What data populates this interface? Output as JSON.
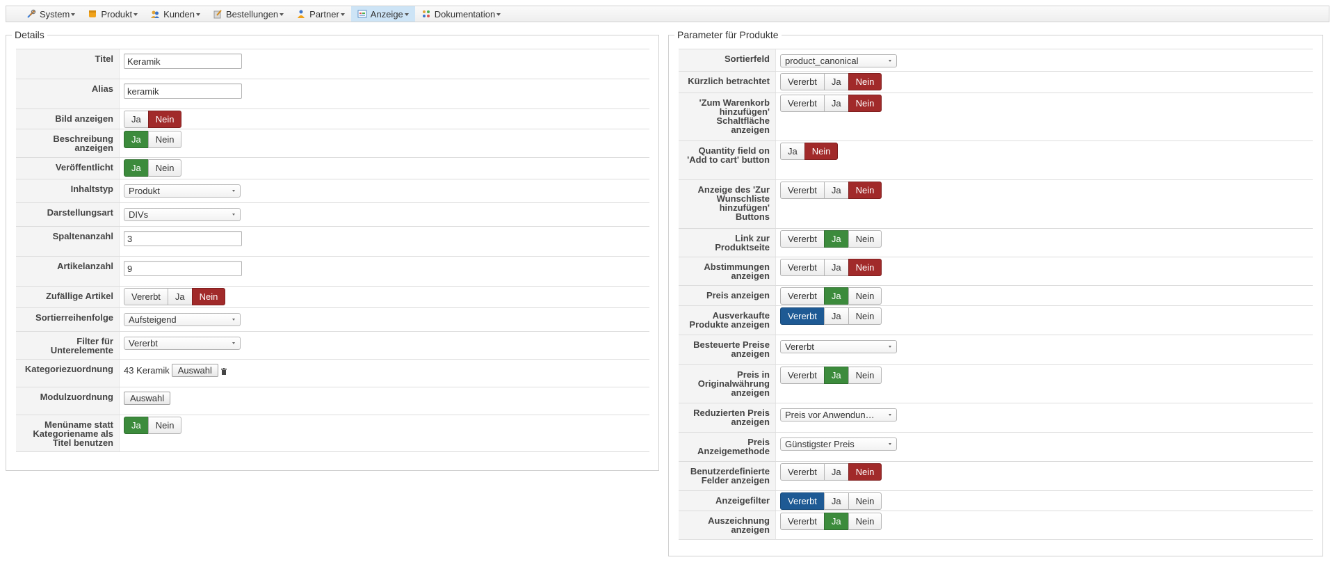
{
  "menu": [
    {
      "label": "System",
      "icon": "tools-icon"
    },
    {
      "label": "Produkt",
      "icon": "product-box-icon"
    },
    {
      "label": "Kunden",
      "icon": "customers-icon"
    },
    {
      "label": "Bestellungen",
      "icon": "orders-icon"
    },
    {
      "label": "Partner",
      "icon": "partner-icon"
    },
    {
      "label": "Anzeige",
      "icon": "display-icon",
      "active": true
    },
    {
      "label": "Dokumentation",
      "icon": "documentation-icon"
    }
  ],
  "details": {
    "legend": "Details",
    "titel": {
      "label": "Titel",
      "value": "Keramik"
    },
    "alias": {
      "label": "Alias",
      "value": "keramik"
    },
    "bild": {
      "label": "Bild anzeigen",
      "options": [
        "Ja",
        "Nein"
      ],
      "selected": "Nein"
    },
    "beschreibung": {
      "label": "Beschreibung anzeigen",
      "options": [
        "Ja",
        "Nein"
      ],
      "selected": "Ja"
    },
    "veroeffentlicht": {
      "label": "Veröffentlicht",
      "options": [
        "Ja",
        "Nein"
      ],
      "selected": "Ja"
    },
    "inhaltstyp": {
      "label": "Inhaltstyp",
      "value": "Produkt"
    },
    "darstellungsart": {
      "label": "Darstellungsart",
      "value": "DIVs"
    },
    "spaltenanzahl": {
      "label": "Spaltenanzahl",
      "value": "3"
    },
    "artikelanzahl": {
      "label": "Artikelanzahl",
      "value": "9"
    },
    "zufaellig": {
      "label": "Zufällige Artikel",
      "options": [
        "Vererbt",
        "Ja",
        "Nein"
      ],
      "selected": "Nein"
    },
    "sortierreihenfolge": {
      "label": "Sortierreihenfolge",
      "value": "Aufsteigend"
    },
    "filter": {
      "label": "Filter für Unterelemente",
      "value": "Vererbt"
    },
    "kategorie": {
      "label": "Kategoriezuordnung",
      "value": "43 Keramik",
      "button": "Auswahl"
    },
    "modul": {
      "label": "Modulzuordnung",
      "button": "Auswahl"
    },
    "menuename": {
      "label": "Menüname statt Kategoriename als Titel benutzen",
      "options": [
        "Ja",
        "Nein"
      ],
      "selected": "Ja"
    }
  },
  "params": {
    "legend": "Parameter für Produkte",
    "sortierfeld": {
      "label": "Sortierfeld",
      "value": "product_canonical"
    },
    "kuerzlich": {
      "label": "Kürzlich betrachtet",
      "options": [
        "Vererbt",
        "Ja",
        "Nein"
      ],
      "selected": "Nein"
    },
    "warenkorb": {
      "label": "'Zum Warenkorb hinzufügen' Schaltfläche anzeigen",
      "options": [
        "Vererbt",
        "Ja",
        "Nein"
      ],
      "selected": "Nein"
    },
    "quantity": {
      "label": "Quantity field on 'Add to cart' button",
      "options": [
        "Ja",
        "Nein"
      ],
      "selected": "Nein"
    },
    "wunschliste": {
      "label": "Anzeige des 'Zur Wunschliste hinzufügen' Buttons",
      "options": [
        "Vererbt",
        "Ja",
        "Nein"
      ],
      "selected": "Nein"
    },
    "link": {
      "label": "Link zur Produktseite",
      "options": [
        "Vererbt",
        "Ja",
        "Nein"
      ],
      "selected": "Ja"
    },
    "abstimmungen": {
      "label": "Abstimmungen anzeigen",
      "options": [
        "Vererbt",
        "Ja",
        "Nein"
      ],
      "selected": "Nein"
    },
    "preis": {
      "label": "Preis anzeigen",
      "options": [
        "Vererbt",
        "Ja",
        "Nein"
      ],
      "selected": "Ja"
    },
    "ausverkauft": {
      "label": "Ausverkaufte Produkte anzeigen",
      "options": [
        "Vererbt",
        "Ja",
        "Nein"
      ],
      "selected": "Vererbt"
    },
    "besteuert": {
      "label": "Besteuerte Preise anzeigen",
      "value": "Vererbt"
    },
    "original": {
      "label": "Preis in Originalwährung anzeigen",
      "options": [
        "Vererbt",
        "Ja",
        "Nein"
      ],
      "selected": "Ja"
    },
    "reduziert": {
      "label": "Reduzierten Preis anzeigen",
      "value": "Preis vor Anwendun…"
    },
    "methode": {
      "label": "Preis Anzeigemethode",
      "value": "Günstigster Preis"
    },
    "benutzer": {
      "label": "Benutzerdefinierte Felder anzeigen",
      "options": [
        "Vererbt",
        "Ja",
        "Nein"
      ],
      "selected": "Nein"
    },
    "anzeigefilter": {
      "label": "Anzeigefilter",
      "options": [
        "Vererbt",
        "Ja",
        "Nein"
      ],
      "selected": "Vererbt"
    },
    "auszeichnung": {
      "label": "Auszeichnung anzeigen",
      "options": [
        "Vererbt",
        "Ja",
        "Nein"
      ],
      "selected": "Ja"
    }
  },
  "colors": {
    "green": "#3c8b3c",
    "red": "#a12a2a",
    "blue": "#1e5a94",
    "active_menu": "#cde4f6"
  }
}
